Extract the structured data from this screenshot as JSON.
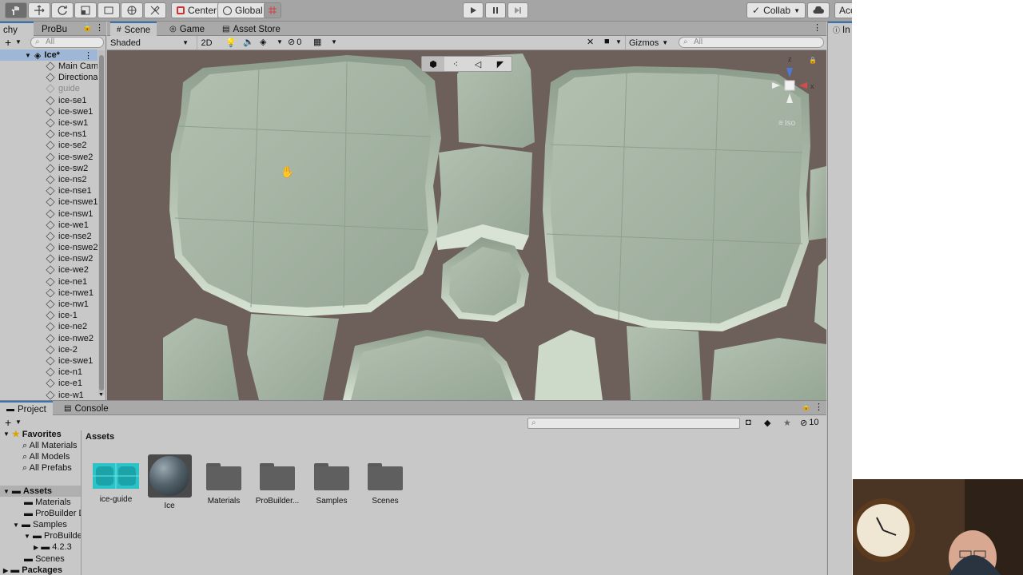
{
  "toolbar": {
    "center_label": "Center",
    "global_label": "Global",
    "collab_label": "Collab",
    "account_label": "Acc"
  },
  "hierarchy": {
    "tab_partial": "chy",
    "tab_probuilder": "ProBu",
    "search_placeholder": "All",
    "scene_name": "Ice*",
    "items": [
      "Main Cam",
      "Directiona",
      "guide",
      "ice-se1",
      "ice-swe1",
      "ice-sw1",
      "ice-ns1",
      "ice-se2",
      "ice-swe2",
      "ice-sw2",
      "ice-ns2",
      "ice-nse1",
      "ice-nswe1",
      "ice-nsw1",
      "ice-we1",
      "ice-nse2",
      "ice-nswe2",
      "ice-nsw2",
      "ice-we2",
      "ice-ne1",
      "ice-nwe1",
      "ice-nw1",
      "ice-1",
      "ice-ne2",
      "ice-nwe2",
      "ice-2",
      "ice-swe1",
      "ice-n1",
      "ice-e1",
      "ice-w1"
    ]
  },
  "scene": {
    "tabs": [
      "Scene",
      "Game",
      "Asset Store"
    ],
    "shading_mode": "Shaded",
    "mode_2d": "2D",
    "hidden_count": "0",
    "gizmos_label": "Gizmos",
    "search_placeholder": "All",
    "gizmo_axis_z": "z",
    "gizmo_axis_x": "x",
    "projection_label": "Iso"
  },
  "inspector": {
    "tab_partial": "In"
  },
  "project": {
    "tabs": [
      "Project",
      "Console"
    ],
    "badge_count": "10",
    "favorites_label": "Favorites",
    "favorites": [
      "All Materials",
      "All Models",
      "All Prefabs"
    ],
    "assets_label": "Assets",
    "tree": [
      "Materials",
      "ProBuilder D",
      "Samples",
      "ProBuilde",
      "4.2.3",
      "Scenes"
    ],
    "packages_label": "Packages",
    "breadcrumb": "Assets",
    "assets": [
      {
        "name": "ice-guide",
        "kind": "texture"
      },
      {
        "name": "Ice",
        "kind": "material"
      },
      {
        "name": "Materials",
        "kind": "folder"
      },
      {
        "name": "ProBuilder...",
        "kind": "folder"
      },
      {
        "name": "Samples",
        "kind": "folder"
      },
      {
        "name": "Scenes",
        "kind": "folder"
      }
    ]
  },
  "colors": {
    "ice": "#a9b8a7",
    "ground": "#6d5f5a",
    "toolbar": "#a5a5a5",
    "panel": "#c8c8c8",
    "accent": "#3a72b0"
  }
}
